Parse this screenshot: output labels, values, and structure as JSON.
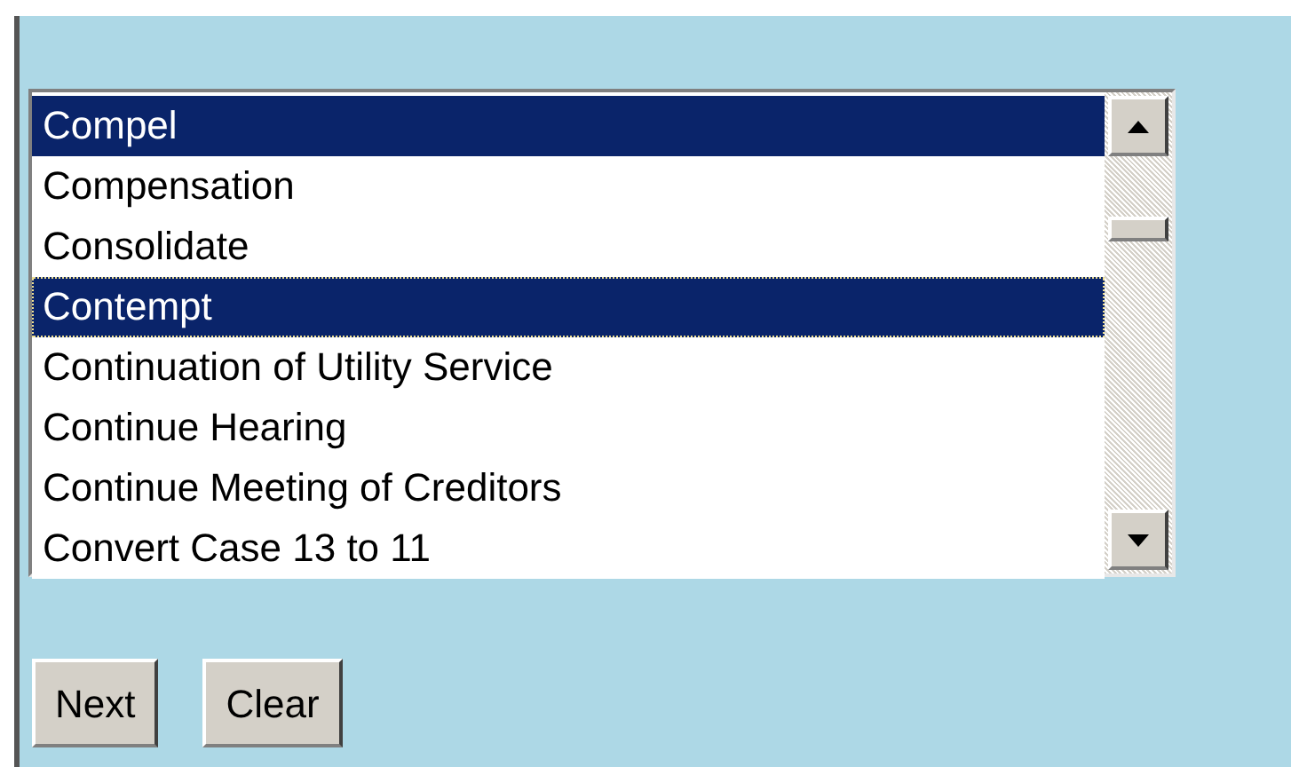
{
  "listbox": {
    "items": [
      {
        "label": "Compel",
        "selected": true,
        "focused": false
      },
      {
        "label": "Compensation",
        "selected": false,
        "focused": false
      },
      {
        "label": "Consolidate",
        "selected": false,
        "focused": false
      },
      {
        "label": "Contempt",
        "selected": true,
        "focused": true
      },
      {
        "label": "Continuation of Utility Service",
        "selected": false,
        "focused": false
      },
      {
        "label": "Continue Hearing",
        "selected": false,
        "focused": false
      },
      {
        "label": "Continue Meeting of Creditors",
        "selected": false,
        "focused": false
      },
      {
        "label": "Convert Case 13 to 11",
        "selected": false,
        "focused": false
      }
    ]
  },
  "buttons": [
    "Next",
    "Clear"
  ]
}
